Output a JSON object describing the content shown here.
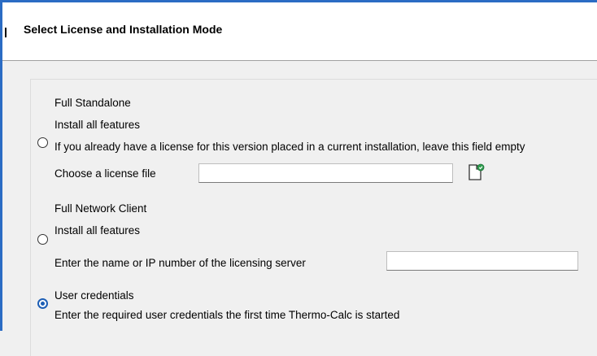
{
  "header": {
    "title": "Select License and Installation Mode"
  },
  "options": {
    "full_standalone": {
      "title": "Full Standalone",
      "subtitle": "Install all features",
      "hint": "If you already have a license for this version placed in a current installation, leave this field empty",
      "license_file_label": "Choose a license file",
      "license_file_value": "",
      "selected": false
    },
    "full_network_client": {
      "title": "Full Network Client",
      "subtitle": "Install all features",
      "server_label": "Enter the name or IP number of the licensing server",
      "server_value": "",
      "selected": false
    },
    "user_credentials": {
      "title": "User credentials",
      "description": "Enter the required user credentials the first time Thermo-Calc is started",
      "selected": true
    }
  },
  "icons": {
    "browse": "open-file-icon"
  },
  "colors": {
    "accent": "#2b6cc4",
    "radio_selected": "#1e5fb5",
    "browse_icon_green": "#2e9e4f"
  }
}
